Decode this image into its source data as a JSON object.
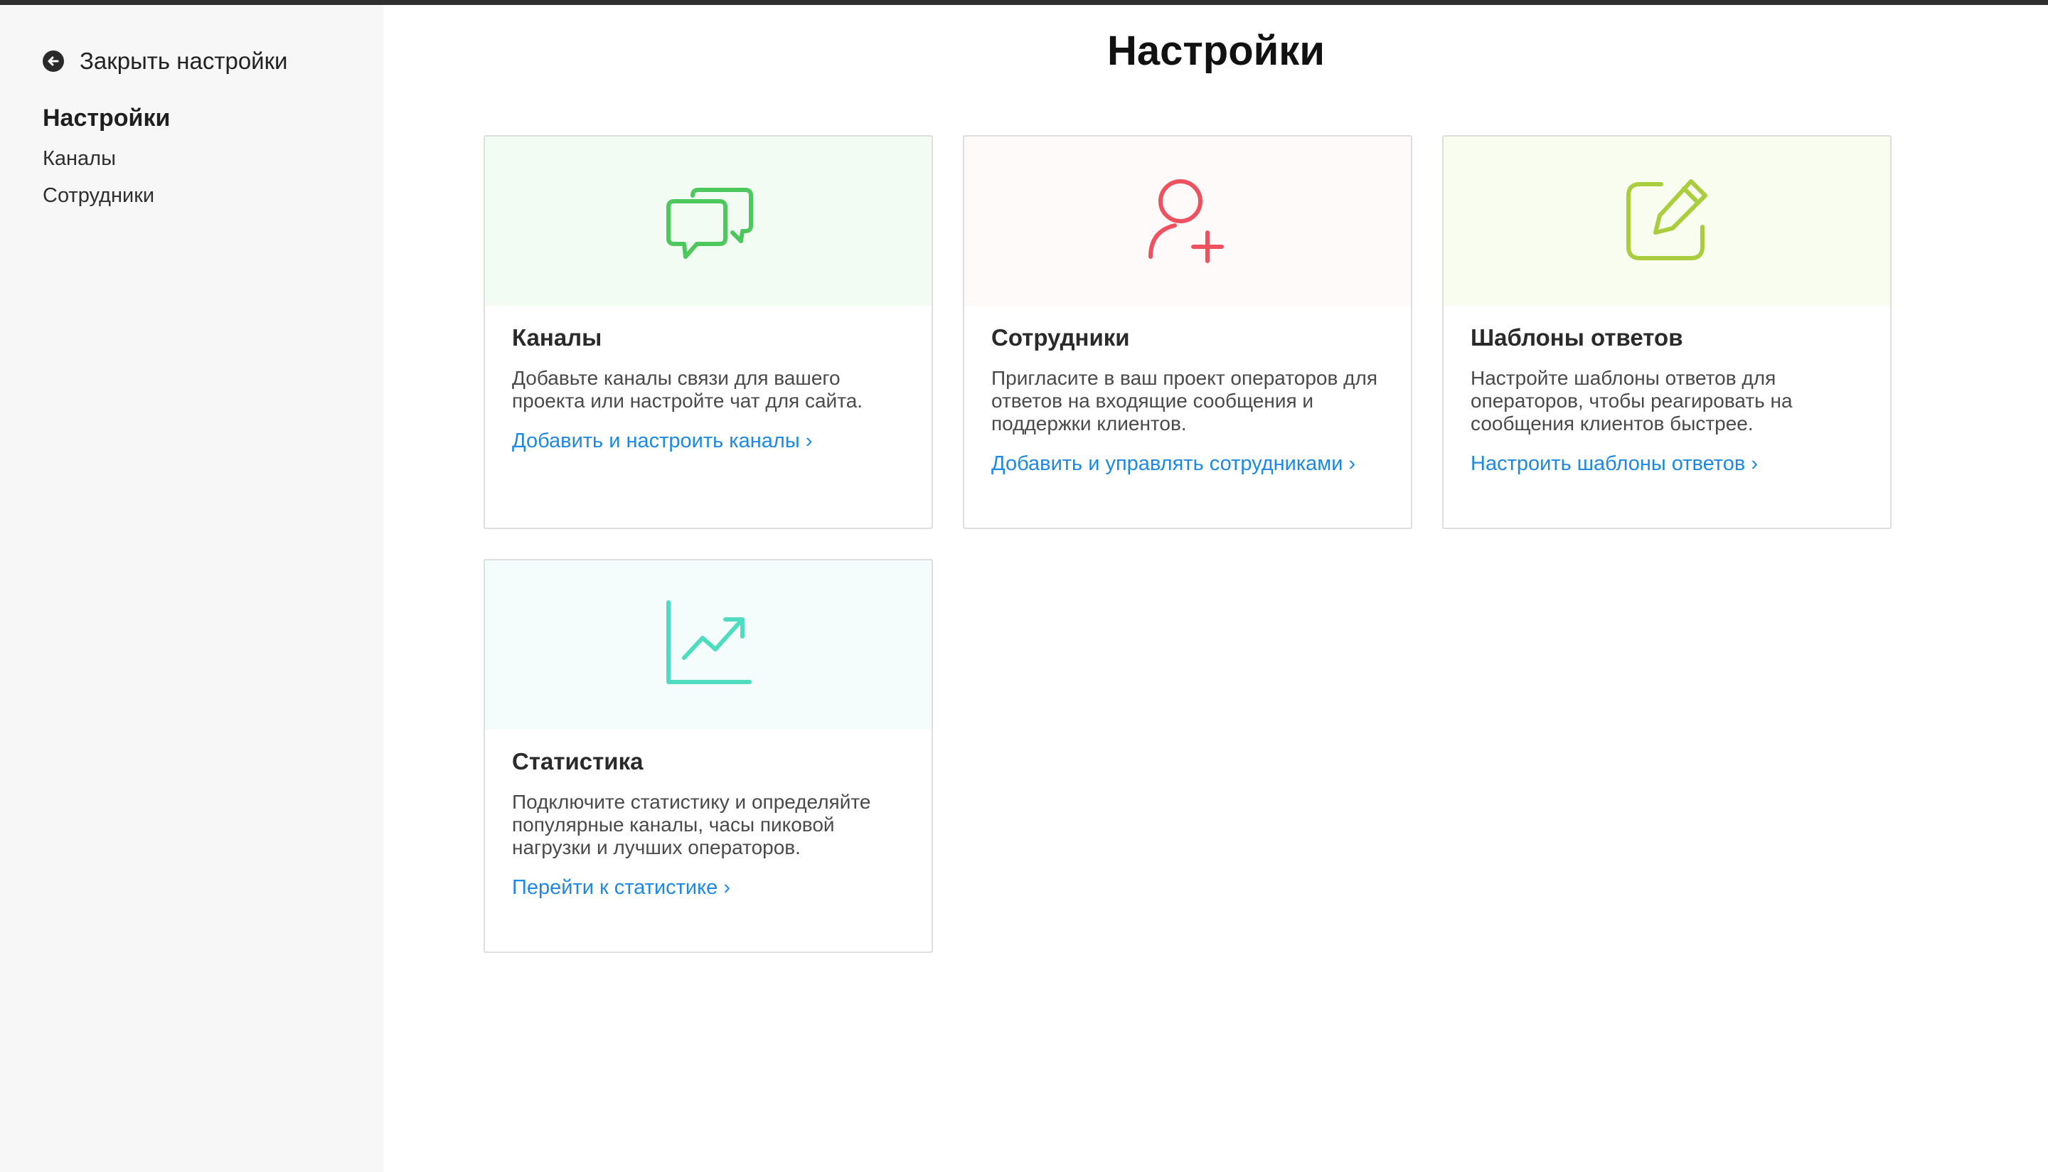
{
  "sidebar": {
    "close_label": "Закрыть настройки",
    "heading": "Настройки",
    "items": [
      {
        "label": "Каналы"
      },
      {
        "label": "Сотрудники"
      }
    ]
  },
  "main": {
    "title": "Настройки",
    "cards": [
      {
        "icon": "chat-bubbles-icon",
        "title": "Каналы",
        "description": "Добавьте каналы связи для вашего проекта или настройте чат для сайта.",
        "link": "Добавить и настроить каналы ›"
      },
      {
        "icon": "add-user-icon",
        "title": "Сотрудники",
        "description": "Пригласите в ваш проект операторов для ответов на входящие сообщения и поддержки клиентов.",
        "link": "Добавить и управлять сотрудниками ›"
      },
      {
        "icon": "edit-note-icon",
        "title": "Шаблоны ответов",
        "description": "Настройте шаблоны ответов для операторов, чтобы реагировать на сообщения клиентов быстрее.",
        "link": "Настроить шаблоны ответов ›"
      },
      {
        "icon": "trend-chart-icon",
        "title": "Статистика",
        "description": "Подключите статистику и определяйте популярные каналы, часы пиковой нагрузки и лучших операторов.",
        "link": "Перейти к статистике ›"
      }
    ]
  },
  "colors": {
    "link": "#1e88e5",
    "channels_icon": "#4cc85c",
    "channels_bg": "#f3fcf3",
    "staff_icon": "#ee5260",
    "staff_bg": "#fffafa",
    "templates_icon": "#a9cd3c",
    "templates_bg": "#f8fdef",
    "stats_icon": "#4fdcc0",
    "stats_bg": "#f4fdfc"
  }
}
